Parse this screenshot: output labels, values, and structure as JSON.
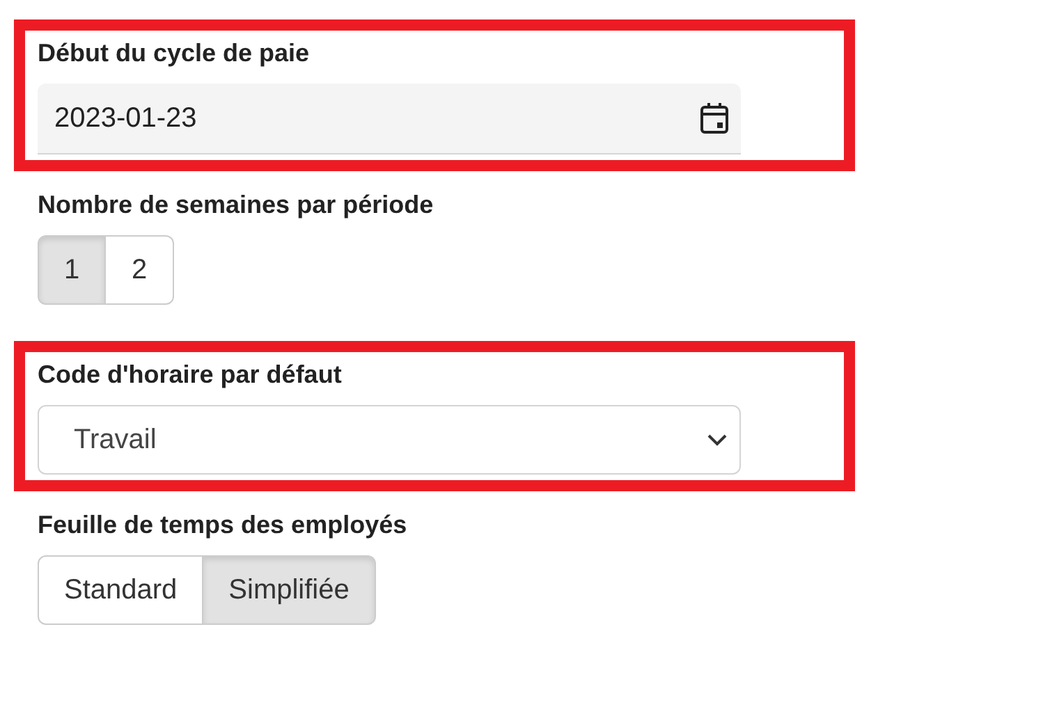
{
  "fields": [
    {
      "kind": "date",
      "label": "Début du cycle de paie",
      "value": "2023-01-23",
      "highlighted": true
    },
    {
      "kind": "toggle",
      "label": "Nombre de semaines par période",
      "options": [
        {
          "label": "1",
          "selected": true
        },
        {
          "label": "2",
          "selected": false
        }
      ],
      "highlighted": false
    },
    {
      "kind": "select",
      "label": "Code d'horaire par défaut",
      "value": "Travail",
      "highlighted": true
    },
    {
      "kind": "toggle",
      "label": "Feuille de temps des employés",
      "options": [
        {
          "label": "Standard",
          "selected": false
        },
        {
          "label": "Simplifiée",
          "selected": true
        }
      ],
      "highlighted": false
    }
  ]
}
